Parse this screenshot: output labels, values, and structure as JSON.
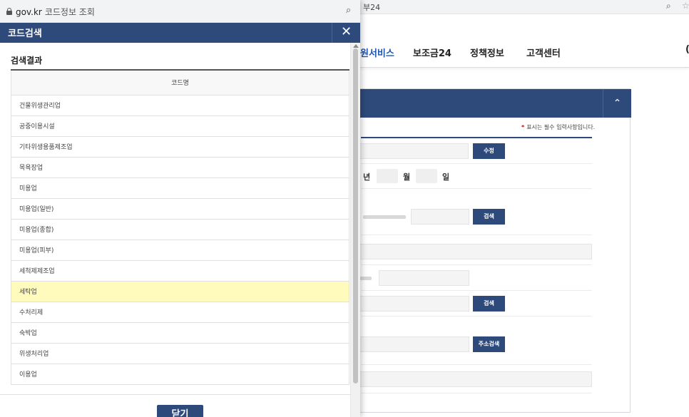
{
  "background_page": {
    "tab_title": "부24",
    "zoom_icon": "zoom-icon",
    "nav_items": [
      "원서비스",
      "보조금24",
      "정책정보",
      "고객센터"
    ],
    "nav_edge": "(",
    "collapse_icon": "chevron-up-icon",
    "required_note": "표시는 필수 입력사항입니다.",
    "required_mark": "*",
    "buttons": {
      "modify": "수정",
      "search1": "검색",
      "search2": "검색",
      "address_search": "주소검색"
    },
    "date_labels": {
      "year": "년",
      "month": "월",
      "day": "일"
    }
  },
  "popup": {
    "address": {
      "site": "gov.kr",
      "page": "코드정보 조회"
    },
    "title": "코드검색",
    "close_label": "✕",
    "result_heading": "검색결과",
    "table": {
      "column_header": "코드명",
      "rows": [
        "건물위생관리업",
        "공중이용시설",
        "기타위생용품제조업",
        "목욕장업",
        "미용업",
        "미용업(일반)",
        "미용업(종합)",
        "미용업(피부)",
        "세척제제조업",
        "세탁업",
        "수처리제",
        "숙박업",
        "위생처리업",
        "이용업"
      ],
      "selected_index": 9
    },
    "close_button_label": "닫기"
  },
  "colors": {
    "primary": "#2e4a7b",
    "selected_row": "#fffbbd",
    "nav_active": "#1e55b0",
    "required_mark": "#d60000"
  }
}
